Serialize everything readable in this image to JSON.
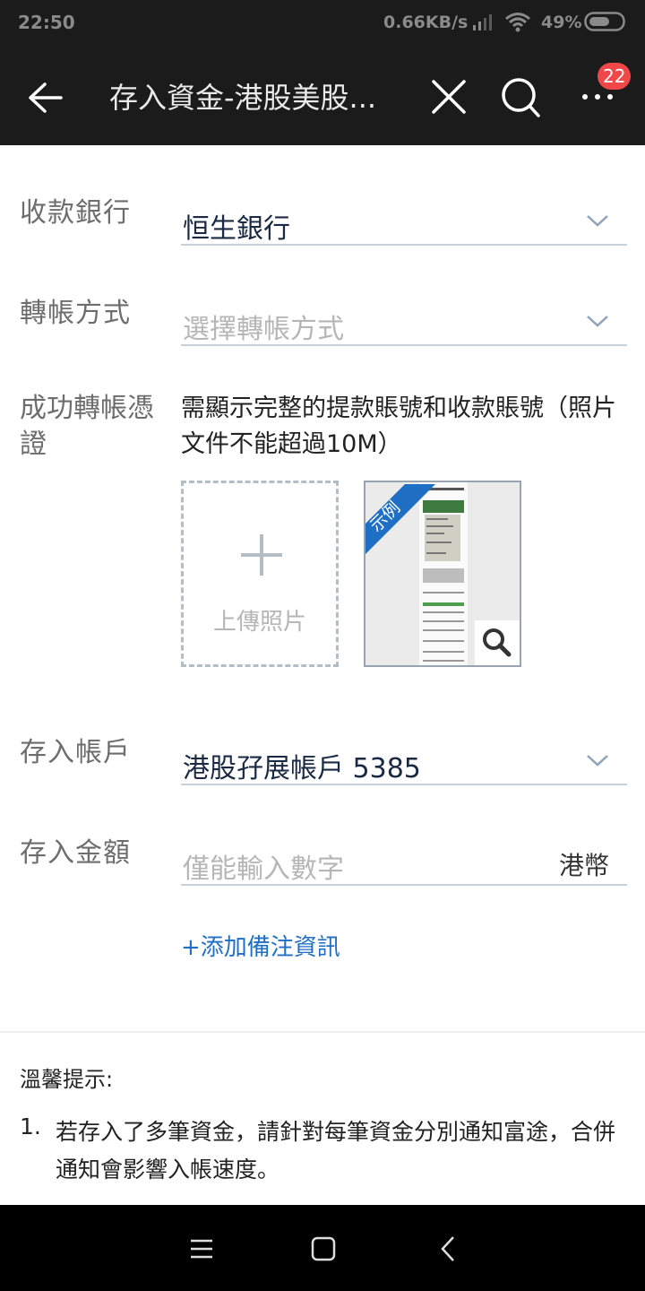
{
  "status_bar": {
    "time": "22:50",
    "speed": "0.66KB/s",
    "battery": "49%"
  },
  "header": {
    "title": "存入資金-港股美股...",
    "badge_count": "22"
  },
  "form": {
    "bank": {
      "label": "收款銀行",
      "value": "恒生銀行"
    },
    "transfer_method": {
      "label": "轉帳方式",
      "placeholder": "選擇轉帳方式"
    },
    "proof": {
      "label": "成功轉帳憑證",
      "description": "需顯示完整的提款賬號和收款賬號（照片文件不能超過10M）",
      "upload_label": "上傳照片",
      "sample_ribbon": "示例"
    },
    "account": {
      "label": "存入帳戶",
      "value": "港股孖展帳戶 5385"
    },
    "amount": {
      "label": "存入金額",
      "placeholder": "僅能輸入數字",
      "unit": "港幣"
    },
    "add_note": "+添加備注資訊"
  },
  "tips": {
    "title": "溫馨提示:",
    "items": [
      {
        "num": "1.",
        "text": "若存入了多筆資金，請針對每筆資金分別通知富途，合併通知會影響入帳速度。"
      }
    ]
  },
  "colors": {
    "accent": "#1f6fc4",
    "badge": "#f04848",
    "header_bg": "#1b1b1b"
  }
}
